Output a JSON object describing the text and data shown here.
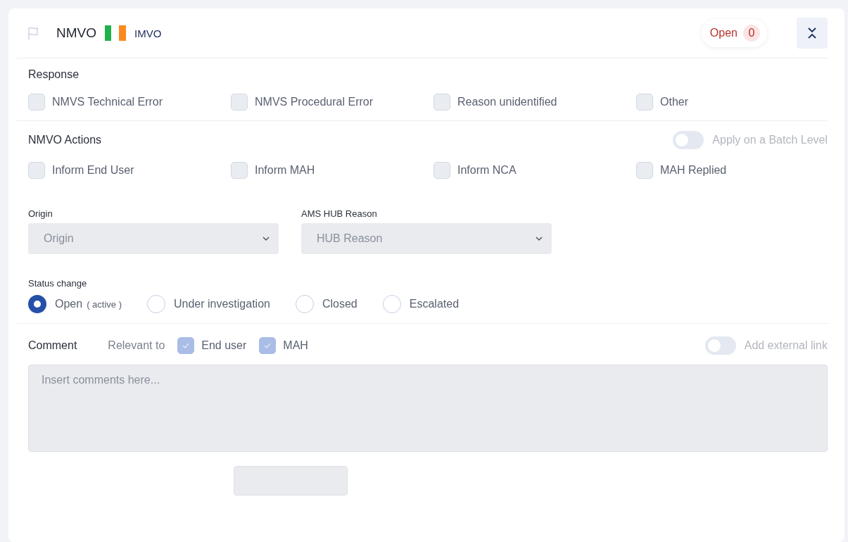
{
  "header": {
    "title": "NMVO",
    "country": "IMVO",
    "status": {
      "label": "Open",
      "count": "0"
    }
  },
  "response": {
    "title": "Response",
    "options": [
      {
        "label": "NMVS Technical Error",
        "checked": false
      },
      {
        "label": "NMVS Procedural Error",
        "checked": false
      },
      {
        "label": "Reason unidentified",
        "checked": false
      },
      {
        "label": "Other",
        "checked": false
      }
    ]
  },
  "actions": {
    "title": "NMVO Actions",
    "toggle": {
      "label": "Apply on a Batch Level",
      "on": false
    },
    "options": [
      {
        "label": "Inform End User",
        "checked": false
      },
      {
        "label": "Inform MAH",
        "checked": false
      },
      {
        "label": "Inform NCA",
        "checked": false
      },
      {
        "label": "MAH Replied",
        "checked": false
      }
    ]
  },
  "selects": [
    {
      "label": "Origin",
      "placeholder": "Origin"
    },
    {
      "label": "AMS HUB Reason",
      "placeholder": "HUB Reason"
    }
  ],
  "status_change": {
    "title": "Status change",
    "options": [
      {
        "label": "Open",
        "note": "( active )",
        "selected": true
      },
      {
        "label": "Under investigation",
        "selected": false
      },
      {
        "label": "Closed",
        "selected": false
      },
      {
        "label": "Escalated",
        "selected": false
      }
    ]
  },
  "comment": {
    "title": "Comment",
    "relevant_label": "Relevant to",
    "relevant": [
      {
        "label": "End user",
        "checked": true
      },
      {
        "label": "MAH",
        "checked": true
      }
    ],
    "toggle": {
      "label": "Add external link",
      "on": false
    },
    "placeholder": "Insert comments here..."
  }
}
